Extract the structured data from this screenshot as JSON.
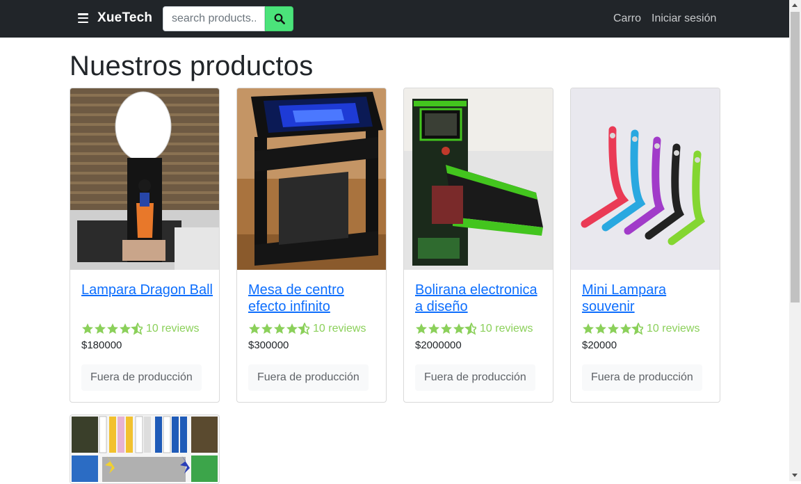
{
  "navbar": {
    "brand": "XueTech",
    "search_placeholder": "search products...",
    "links": {
      "cart": "Carro",
      "login": "Iniciar sesión"
    },
    "colors": {
      "background": "#212529",
      "search_button": "#4be37a"
    }
  },
  "page_title": "Nuestros productos",
  "products": [
    {
      "name": "Lampara Dragon Ball",
      "reviews": "10 reviews",
      "price": "$180000",
      "status": "Fuera de producción",
      "image_icon": "dragon-ball-lamp-image",
      "rating": 4.5
    },
    {
      "name": "Mesa de centro efecto infinito",
      "reviews": "10 reviews",
      "price": "$300000",
      "status": "Fuera de producción",
      "image_icon": "infinity-table-image",
      "rating": 4.5
    },
    {
      "name": "Bolirana electronica a diseño",
      "reviews": "10 reviews",
      "price": "$2000000",
      "status": "Fuera de producción",
      "image_icon": "bolirana-machine-image",
      "rating": 4.5
    },
    {
      "name": "Mini Lampara souvenir",
      "reviews": "10 reviews",
      "price": "$20000",
      "status": "Fuera de producción",
      "image_icon": "mini-lamps-image",
      "rating": 4.5
    }
  ],
  "colors": {
    "link": "#0d6efd",
    "rating": "#8bd05a"
  }
}
